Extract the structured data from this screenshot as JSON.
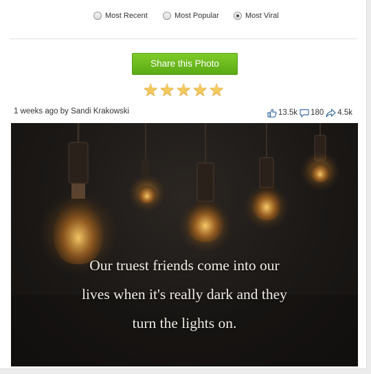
{
  "sort": {
    "options": [
      {
        "label": "Most Recent",
        "checked": false
      },
      {
        "label": "Most Popular",
        "checked": false
      },
      {
        "label": "Most Viral",
        "checked": true
      }
    ]
  },
  "share": {
    "label": "Share this Photo"
  },
  "rating": {
    "value": 5,
    "max": 5,
    "star_glyph": "★"
  },
  "post": {
    "meta": "1 weeks ago by Sandi Krakowski",
    "likes": "13.5k",
    "comments": "180",
    "shares": "4.5k"
  },
  "photo": {
    "quote_lines": [
      "Our truest friends come into our",
      "lives when it's really dark and they",
      "turn the lights on."
    ]
  },
  "colors": {
    "share_button": "#6cbb1f",
    "star": "#f4c95d",
    "icon_blue": "#3b6ea8"
  }
}
